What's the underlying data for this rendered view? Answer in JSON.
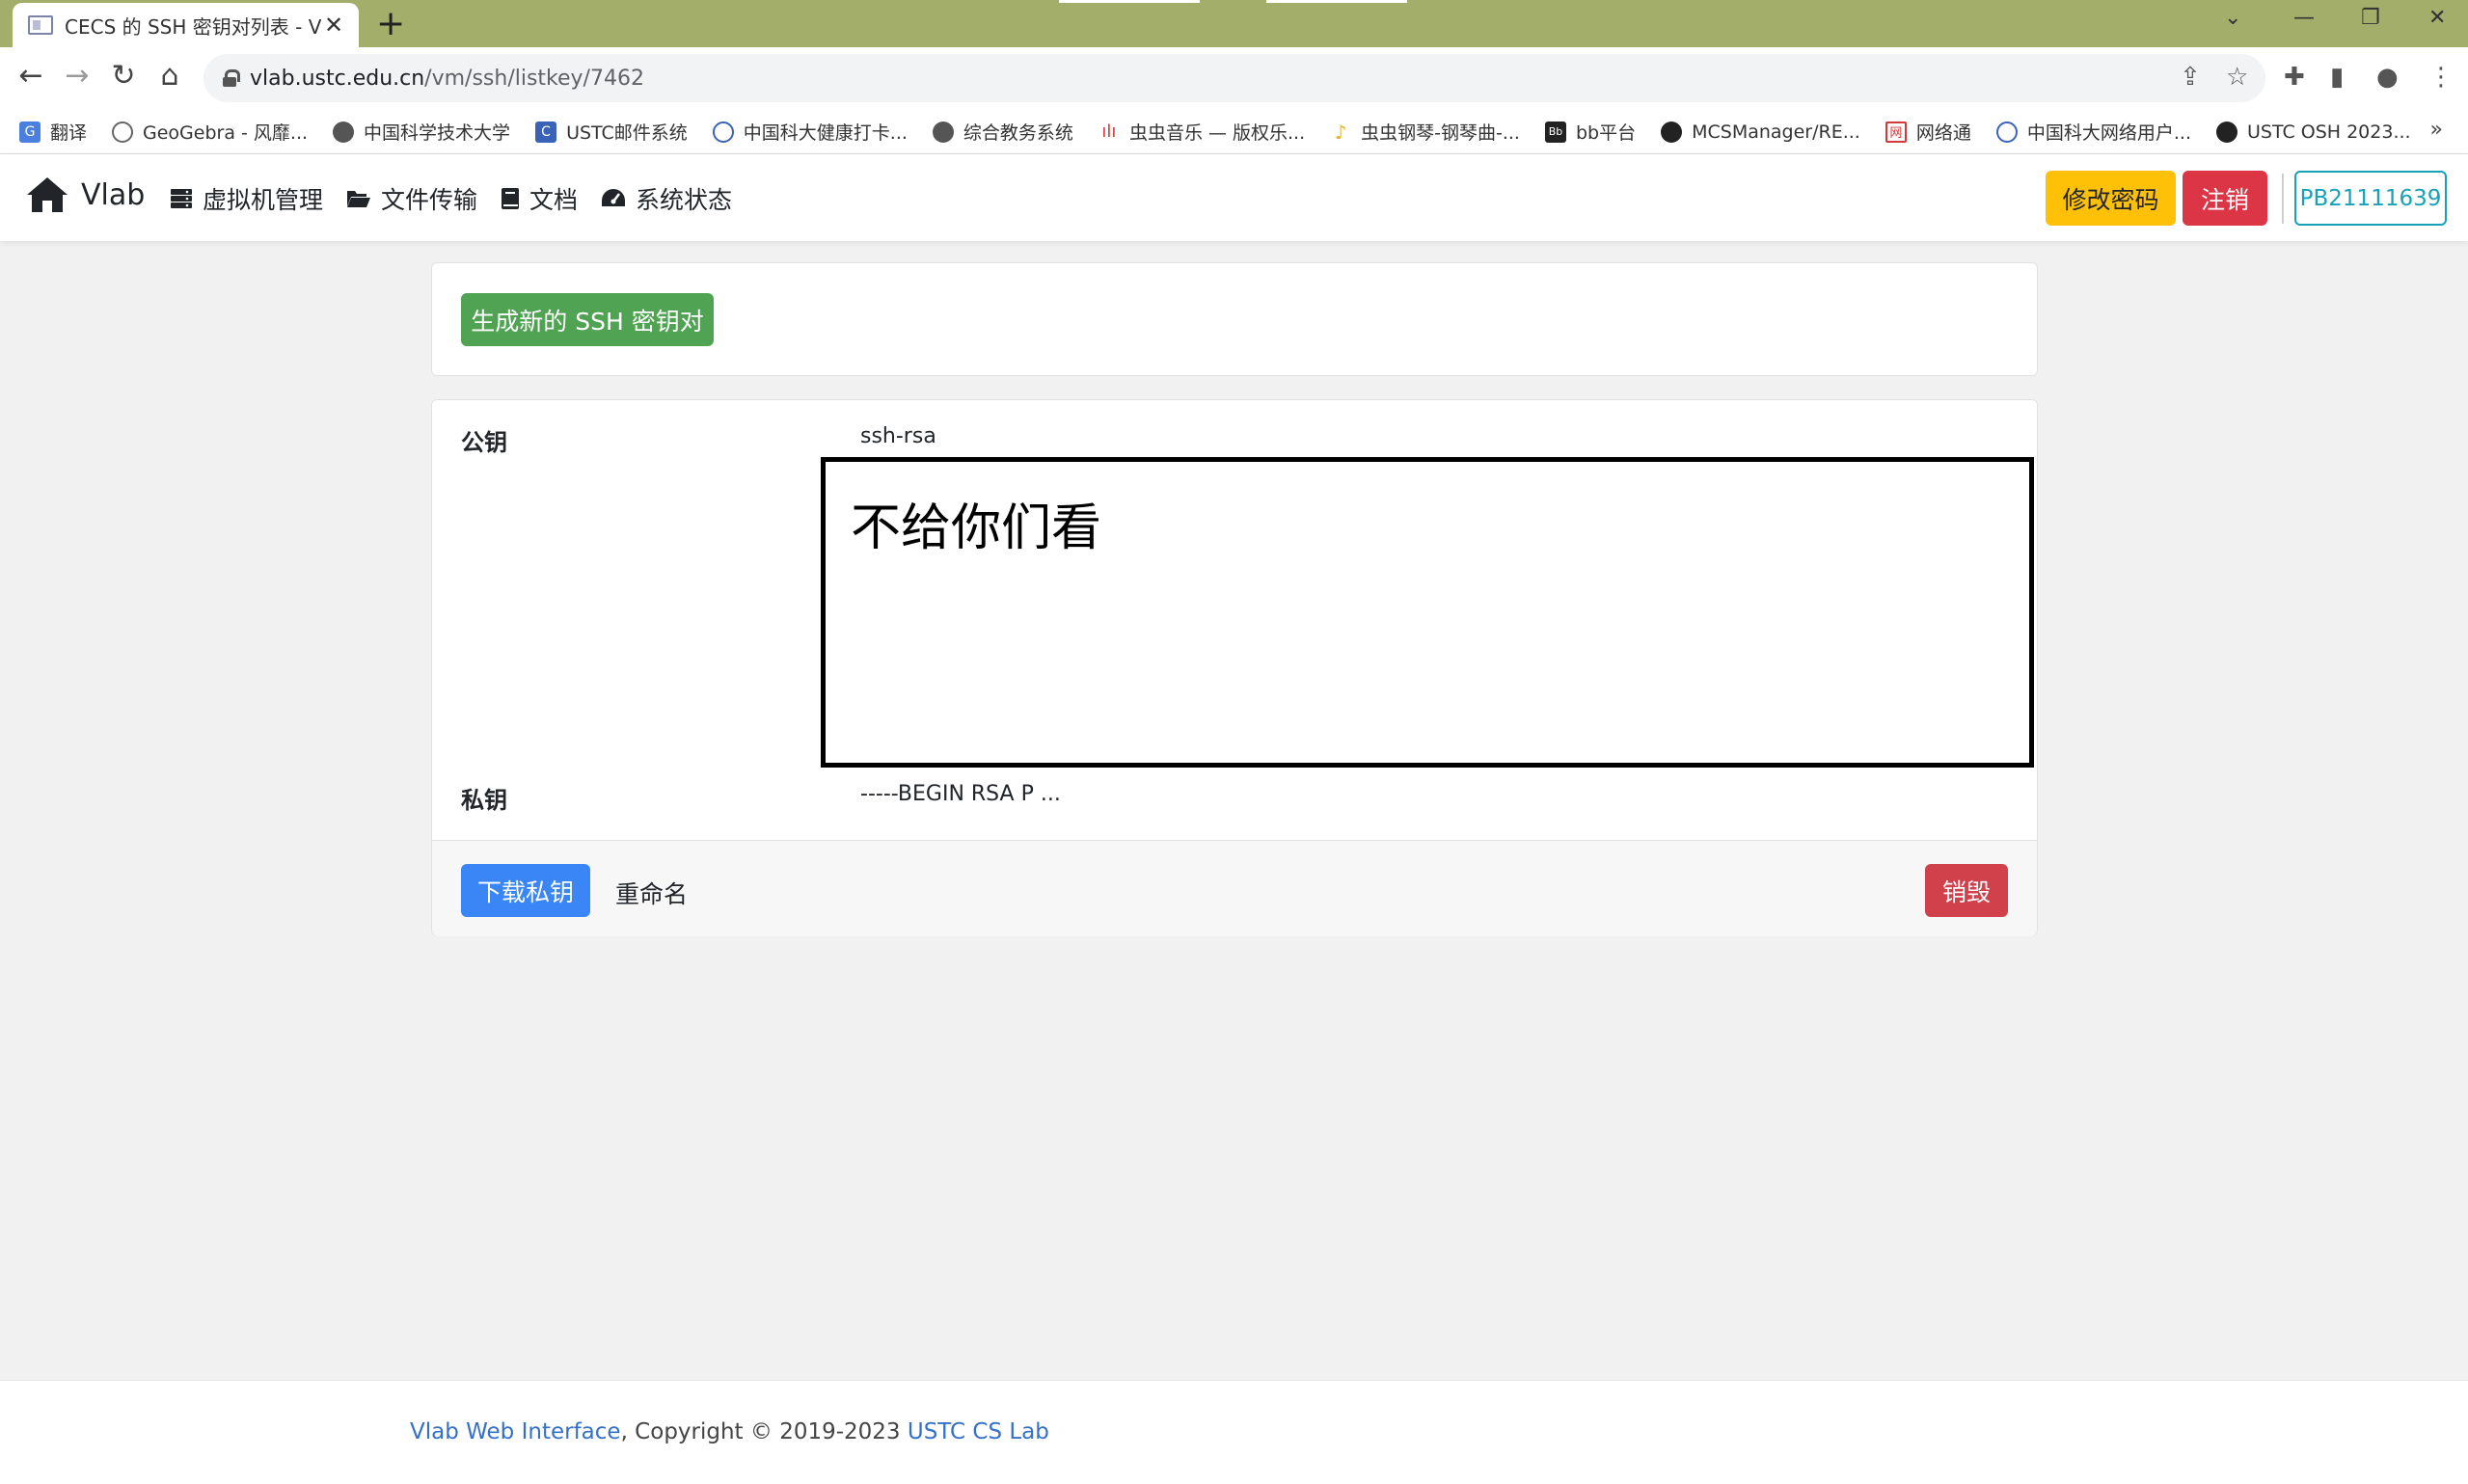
{
  "browser": {
    "tab_title": "CECS 的 SSH 密钥对列表 - Vlab",
    "tab_close": "✕",
    "new_tab": "+",
    "url_host": "vlab.ustc.edu.cn",
    "url_path": "/vm/ssh/listkey/7462",
    "bookmarks": [
      {
        "label": "翻译",
        "icon": "translate-icon",
        "color": "#4a7fe0"
      },
      {
        "label": "GeoGebra - 风靡...",
        "icon": "geogebra-icon",
        "color": "#666666"
      },
      {
        "label": "中国科学技术大学",
        "icon": "globe-icon",
        "color": "#555555"
      },
      {
        "label": "USTC邮件系统",
        "icon": "mail-c-icon",
        "color": "#3a63b8"
      },
      {
        "label": "中国科大健康打卡...",
        "icon": "ustc-seal-icon",
        "color": "#3a63b8"
      },
      {
        "label": "综合教务系统",
        "icon": "globe-icon",
        "color": "#555555"
      },
      {
        "label": "虫虫音乐 — 版权乐...",
        "icon": "music-icon",
        "color": "#d23a3a"
      },
      {
        "label": "虫虫钢琴-钢琴曲-...",
        "icon": "piano-icon",
        "color": "#e2b431"
      },
      {
        "label": "bb平台",
        "icon": "bb-icon",
        "color": "#222222"
      },
      {
        "label": "MCSManager/RE...",
        "icon": "github-icon",
        "color": "#222222"
      },
      {
        "label": "网络通",
        "icon": "network-icon",
        "color": "#d23a3a"
      },
      {
        "label": "中国科大网络用户...",
        "icon": "ustc-seal-icon",
        "color": "#3a63b8"
      },
      {
        "label": "USTC OSH 2023...",
        "icon": "osh-icon",
        "color": "#222222"
      }
    ],
    "bookmarks_more": "»"
  },
  "navbar": {
    "brand": "Vlab",
    "links": [
      {
        "label": "虚拟机管理",
        "icon": "server-icon"
      },
      {
        "label": "文件传输",
        "icon": "folder-open-icon"
      },
      {
        "label": "文档",
        "icon": "book-icon"
      },
      {
        "label": "系统状态",
        "icon": "dashboard-icon"
      }
    ],
    "change_password": "修改密码",
    "logout": "注销",
    "user_id": "PB21111639"
  },
  "main": {
    "generate_button": "生成新的 SSH 密钥对",
    "public_key_label": "公钥",
    "public_key_value": "ssh-rsa",
    "cover_text": "不给你们看",
    "private_key_label": "私钥",
    "private_key_value": "-----BEGIN RSA P ...",
    "download_button": "下载私钥",
    "rename_link": "重命名",
    "destroy_button": "销毁"
  },
  "footer": {
    "app_link": "Vlab Web Interface",
    "copyright": ", Copyright © 2019-2023 ",
    "lab_link": "USTC CS Lab"
  },
  "colors": {
    "tabbar": "#a2ae6a",
    "success": "#4fa352",
    "primary": "#3a86f7",
    "danger": "#dc3545",
    "warning": "#ffc107",
    "info": "#17a2b8"
  }
}
